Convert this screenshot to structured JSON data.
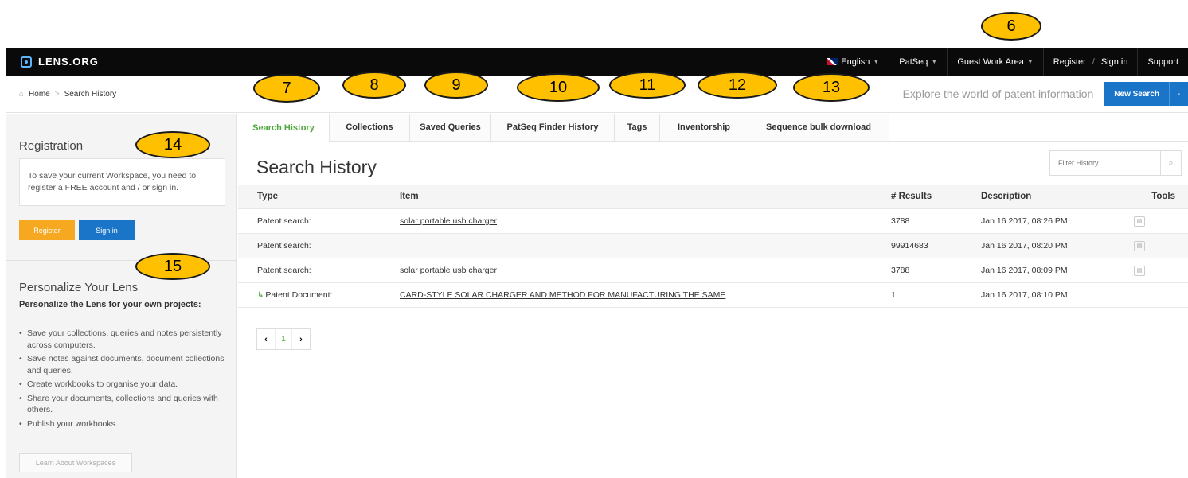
{
  "brand": {
    "name": "LENS.ORG"
  },
  "topnav": {
    "language": "English",
    "patseq": "PatSeq",
    "guest": "Guest Work Area",
    "register": "Register",
    "sep": "/",
    "signin": "Sign in",
    "support": "Support"
  },
  "breadcrumb": {
    "home": "Home",
    "sep": ">",
    "current": "Search History"
  },
  "tagline": "Explore the world of patent information",
  "new_search": {
    "label": "New Search",
    "dropdown": "-"
  },
  "sidebar": {
    "registration_title": "Registration",
    "registration_text": "To save your current Workspace, you need to register a FREE account and / or sign in.",
    "register_button": "Register",
    "signin_button": "Sign in",
    "personalize_title": "Personalize Your Lens",
    "personalize_subtitle": "Personalize the Lens for your own projects:",
    "items": [
      "Save your collections, queries and notes persistently across computers.",
      "Save notes against documents, document collections and queries.",
      "Create workbooks to organise your data.",
      "Share your documents, collections and queries with others.",
      "Publish your workbooks."
    ],
    "learn_button": "Learn About Workspaces"
  },
  "tabs": [
    {
      "label": "Search History"
    },
    {
      "label": "Collections"
    },
    {
      "label": "Saved Queries"
    },
    {
      "label": "PatSeq Finder History"
    },
    {
      "label": "Tags"
    },
    {
      "label": "Inventorship"
    },
    {
      "label": "Sequence bulk download"
    }
  ],
  "main": {
    "title": "Search History",
    "filter_placeholder": "Filter History"
  },
  "table": {
    "headers": {
      "type": "Type",
      "item": "Item",
      "results": "# Results",
      "description": "Description",
      "tools": "Tools"
    },
    "rows": [
      {
        "type": "Patent search:",
        "item": "solar portable usb charger",
        "results": "3788",
        "description": "Jan 16 2017, 08:26 PM"
      },
      {
        "type": "Patent search:",
        "item": "",
        "results": "99914683",
        "description": "Jan 16 2017, 08:20 PM"
      },
      {
        "type": "Patent search:",
        "item": "solar portable usb charger",
        "results": "3788",
        "description": "Jan 16 2017, 08:09 PM"
      },
      {
        "type": "Patent Document:",
        "item": "CARD-STYLE SOLAR CHARGER AND METHOD FOR MANUFACTURING THE SAME",
        "results": "1",
        "description": "Jan 16 2017, 08:10 PM"
      }
    ]
  },
  "pager": {
    "prev": "‹",
    "page": "1",
    "next": "›"
  },
  "callouts": [
    "6",
    "7",
    "8",
    "9",
    "10",
    "11",
    "12",
    "13",
    "14",
    "15"
  ]
}
